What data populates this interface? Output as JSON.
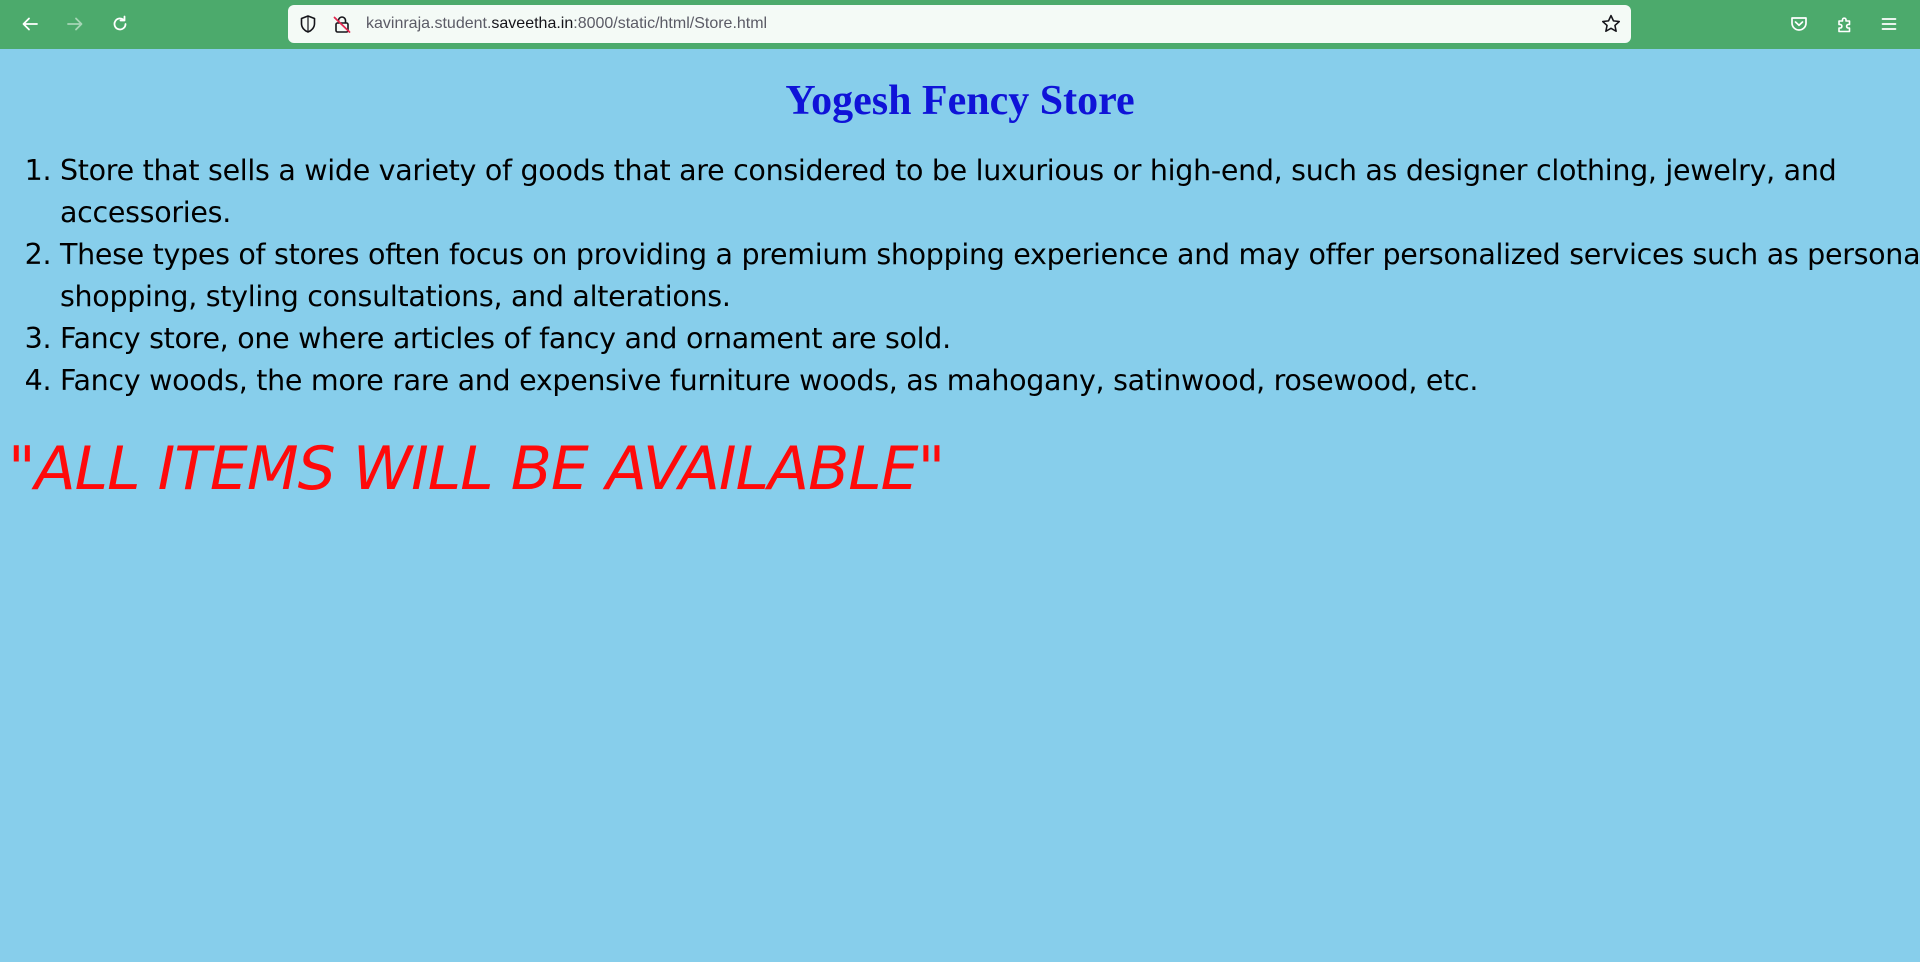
{
  "browser": {
    "url_prefix": "kavinraja.student.",
    "url_host": "saveetha.in",
    "url_suffix": ":8000/static/html/Store.html",
    "icons": {
      "back": "arrow-left-icon",
      "forward": "arrow-right-icon",
      "reload": "reload-icon",
      "shield": "shield-icon",
      "insecure": "insecure-lock-icon",
      "bookmark": "star-icon",
      "pocket": "pocket-icon",
      "extensions": "puzzle-icon",
      "menu": "hamburger-icon"
    },
    "colors": {
      "toolbar": "#4caa6c",
      "urlbar": "#f4faf6"
    }
  },
  "page": {
    "title": "Yogesh Fency Store",
    "items": [
      "Store that sells a wide variety of goods that are considered to be luxurious or high-end, such as designer clothing, jewelry, and accessories.",
      "These types of stores often focus on providing a premium shopping experience and may offer personalized services such as personal shopping, styling consultations, and alterations.",
      "Fancy store, one where articles of fancy and ornament are sold.",
      "Fancy woods, the more rare and expensive furniture woods, as mahogany, satinwood, rosewood, etc."
    ],
    "banner": "\"ALL ITEMS WILL BE AVAILABLE\"",
    "colors": {
      "background": "#87ceeb",
      "title": "#0f13d8",
      "banner": "#ff0a0a"
    }
  }
}
